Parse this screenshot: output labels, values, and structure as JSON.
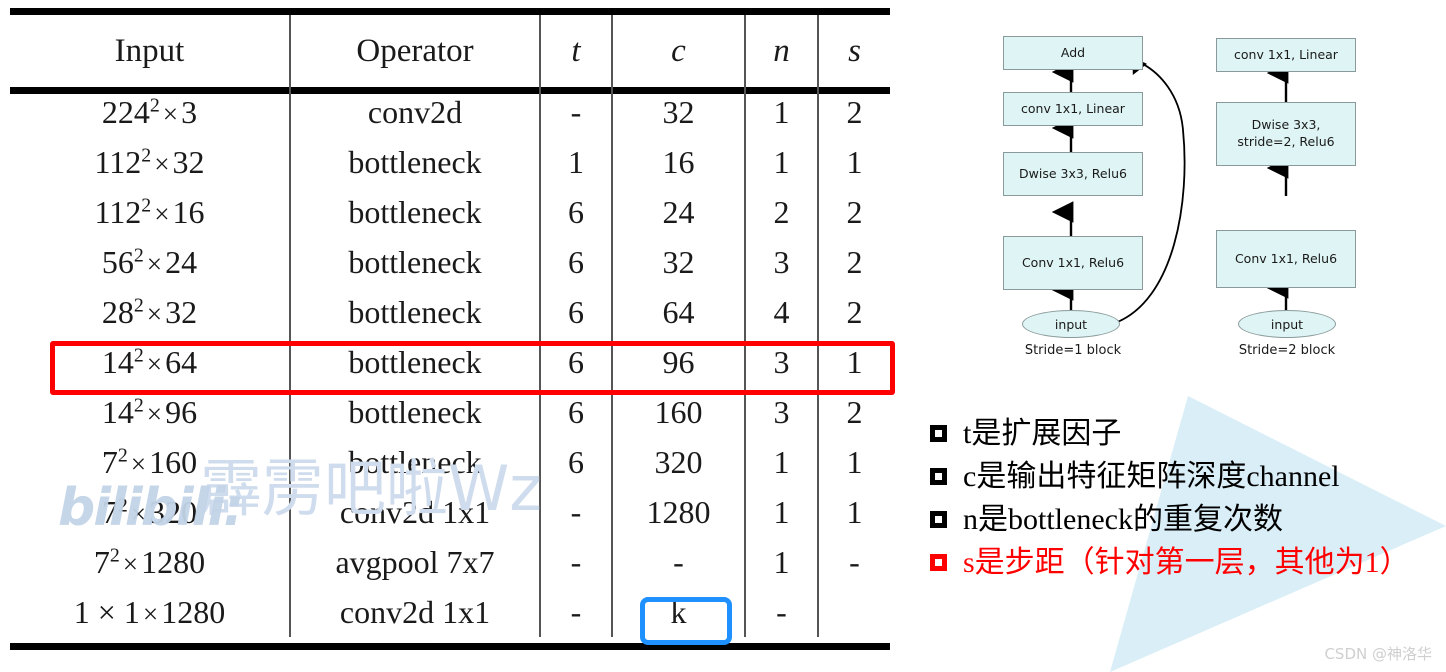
{
  "table": {
    "columns": [
      "Input",
      "Operator",
      "t",
      "c",
      "n",
      "s"
    ],
    "rows": [
      {
        "input_base": "224",
        "input_sup": "2",
        "input_mult": "3",
        "operator": "conv2d",
        "t": "-",
        "c": "32",
        "n": "1",
        "s": "2"
      },
      {
        "input_base": "112",
        "input_sup": "2",
        "input_mult": "32",
        "operator": "bottleneck",
        "t": "1",
        "c": "16",
        "n": "1",
        "s": "1"
      },
      {
        "input_base": "112",
        "input_sup": "2",
        "input_mult": "16",
        "operator": "bottleneck",
        "t": "6",
        "c": "24",
        "n": "2",
        "s": "2"
      },
      {
        "input_base": "56",
        "input_sup": "2",
        "input_mult": "24",
        "operator": "bottleneck",
        "t": "6",
        "c": "32",
        "n": "3",
        "s": "2"
      },
      {
        "input_base": "28",
        "input_sup": "2",
        "input_mult": "32",
        "operator": "bottleneck",
        "t": "6",
        "c": "64",
        "n": "4",
        "s": "2"
      },
      {
        "input_base": "14",
        "input_sup": "2",
        "input_mult": "64",
        "operator": "bottleneck",
        "t": "6",
        "c": "96",
        "n": "3",
        "s": "1"
      },
      {
        "input_base": "14",
        "input_sup": "2",
        "input_mult": "96",
        "operator": "bottleneck",
        "t": "6",
        "c": "160",
        "n": "3",
        "s": "2"
      },
      {
        "input_base": "7",
        "input_sup": "2",
        "input_mult": "160",
        "operator": "bottleneck",
        "t": "6",
        "c": "320",
        "n": "1",
        "s": "1"
      },
      {
        "input_base": "7",
        "input_sup": "2",
        "input_mult": "320",
        "operator": "conv2d 1x1",
        "t": "-",
        "c": "1280",
        "n": "1",
        "s": "1"
      },
      {
        "input_base": "7",
        "input_sup": "2",
        "input_mult": "1280",
        "operator": "avgpool 7x7",
        "t": "-",
        "c": "-",
        "n": "1",
        "s": "-"
      },
      {
        "input_base": "1 × 1",
        "input_sup": "",
        "input_mult": "1280",
        "operator": "conv2d 1x1",
        "t": "-",
        "c": "k",
        "n": "-",
        "s": ""
      }
    ],
    "highlight_row_index": 5,
    "highlight_color": "#ff0000",
    "k_box_color": "#1e90ff"
  },
  "watermarks": {
    "bilibili": "bilibili:",
    "bilibili_cn": "霹雳吧啦Wz",
    "csdn": "CSDN @神洛华",
    "watermark_color": "#cfdced"
  },
  "diagrams": {
    "stride1": {
      "caption": "Stride=1 block",
      "nodes": {
        "add": "Add",
        "conv_linear": "conv 1x1, Linear",
        "dwise": "Dwise 3x3, Relu6",
        "conv_relu": "Conv 1x1, Relu6",
        "input": "input"
      }
    },
    "stride2": {
      "caption": "Stride=2 block",
      "nodes": {
        "conv_linear": "conv 1x1, Linear",
        "dwise_line1": "Dwise 3x3,",
        "dwise_line2": "stride=2, Relu6",
        "conv_relu": "Conv 1x1, Relu6",
        "input": "input"
      }
    },
    "box_fill": "#dff4f4",
    "box_border": "#8a9a9a"
  },
  "bullets": [
    {
      "text": "t是扩展因子",
      "color": "black"
    },
    {
      "text": "c是输出特征矩阵深度channel",
      "color": "black"
    },
    {
      "text": "n是bottleneck的重复次数",
      "color": "black"
    },
    {
      "text": "s是步距（针对第一层，其他为1）",
      "color": "red"
    }
  ]
}
